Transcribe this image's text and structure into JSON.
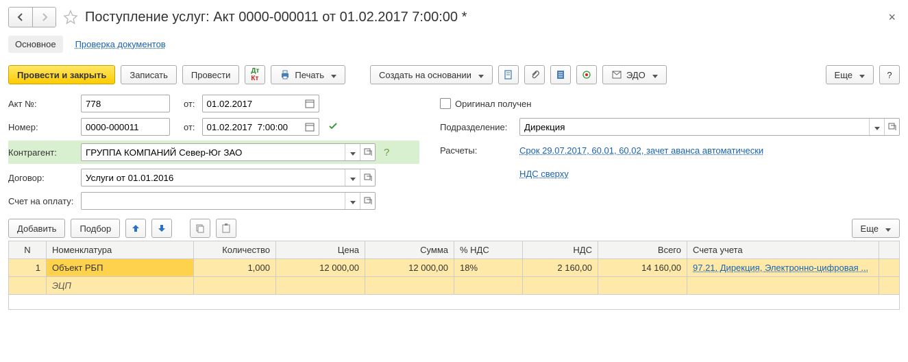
{
  "title": "Поступление услуг: Акт 0000-000011 от 01.02.2017 7:00:00 *",
  "tabs": {
    "main": "Основное",
    "check": "Проверка документов"
  },
  "toolbar": {
    "post_close": "Провести и закрыть",
    "save": "Записать",
    "post": "Провести",
    "print": "Печать",
    "create_based": "Создать на основании",
    "edo": "ЭДО",
    "more": "Еще",
    "help": "?"
  },
  "form": {
    "akt_no_label": "Акт №:",
    "akt_no": "778",
    "ot": "от:",
    "akt_date": "01.02.2017",
    "number_label": "Номер:",
    "number": "0000-000011",
    "number_date": "01.02.2017  7:00:00",
    "kontragent_label": "Контрагент:",
    "kontragent": "ГРУППА КОМПАНИЙ Север-Юг ЗАО",
    "dogovor_label": "Договор:",
    "dogovor": "Услуги от 01.01.2016",
    "schet_label": "Счет на оплату:",
    "schet": "",
    "original_label": "Оригинал получен",
    "podrazd_label": "Подразделение:",
    "podrazd": "Дирекция",
    "raschety_label": "Расчеты:",
    "raschety_link": "Срок 29.07.2017, 60.01, 60.02, зачет аванса автоматически",
    "nds_link": "НДС сверху"
  },
  "table_toolbar": {
    "add": "Добавить",
    "pick": "Подбор",
    "more": "Еще"
  },
  "table": {
    "headers": {
      "n": "N",
      "nomen": "Номенклатура",
      "qty": "Количество",
      "price": "Цена",
      "sum": "Сумма",
      "vat_pct": "% НДС",
      "vat": "НДС",
      "total": "Всего",
      "accounts": "Счета учета"
    },
    "rows": [
      {
        "n": "1",
        "nomen": "Объект РБП",
        "nomen_sub": "ЭЦП",
        "qty": "1,000",
        "price": "12 000,00",
        "sum": "12 000,00",
        "vat_pct": "18%",
        "vat": "2 160,00",
        "total": "14 160,00",
        "accounts": "97.21, Дирекция, Электронно-цифровая ..."
      }
    ]
  }
}
